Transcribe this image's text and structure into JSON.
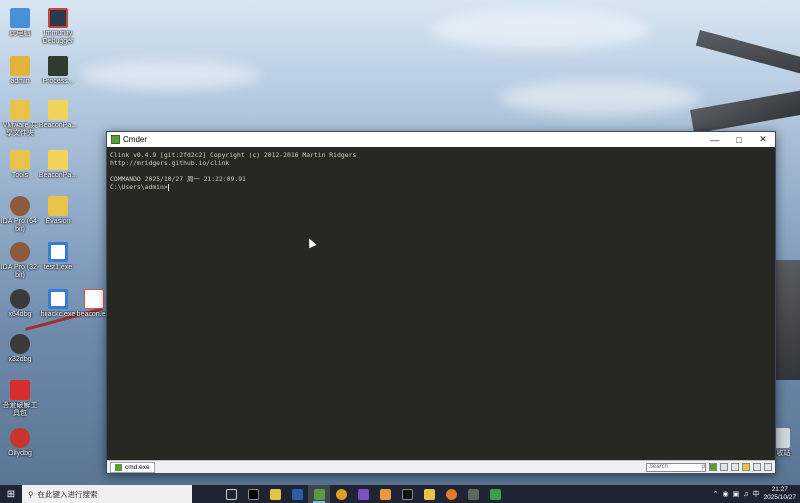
{
  "desktop": {
    "icons": [
      {
        "label": "此电脑",
        "color": "#4a90d9",
        "icon": "computer-icon"
      },
      {
        "label": "Immunity Debugger",
        "color": "#2b3b4e",
        "icon": "immunity-debugger-icon"
      },
      {
        "label": "admin",
        "color": "#e2b33a",
        "icon": "user-folder-icon"
      },
      {
        "label": "Process...",
        "color": "#2e3b2e",
        "icon": "process-monitor-icon"
      },
      {
        "label": "VMware 共享文件夹",
        "color": "#e8c34a",
        "icon": "folder-icon"
      },
      {
        "label": "BeaconPa...",
        "color": "#f2d45c",
        "icon": "file-icon"
      },
      {
        "label": "Tools",
        "color": "#e8c34a",
        "icon": "folder-icon"
      },
      {
        "label": "BeaconPa...",
        "color": "#f2d45c",
        "icon": "file-icon"
      },
      {
        "label": "IDA Pro (64-bit)",
        "color": "#8c5a3c",
        "icon": "ida-pro-icon"
      },
      {
        "label": "Evasion",
        "color": "#e8c34a",
        "icon": "folder-icon"
      },
      {
        "label": "IDA Pro (32-bit)",
        "color": "#8c5a3c",
        "icon": "ida-pro-icon"
      },
      {
        "label": "test1.exe",
        "color": "#3a7bd5",
        "icon": "exe-icon"
      },
      {
        "label": "x64dbg",
        "color": "#3a3a3a",
        "icon": "x64dbg-icon"
      },
      {
        "label": "hijackc.exe",
        "color": "#3a7bd5",
        "icon": "exe-icon"
      },
      {
        "label": "beacon.e...",
        "color": "#d9534f",
        "icon": "pdf-icon"
      },
      {
        "label": "x32dbg",
        "color": "#3a3a3a",
        "icon": "x32dbg-icon"
      },
      {
        "label": "吾爱破解工具包",
        "color": "#d62e2e",
        "icon": "toolkit-icon"
      },
      {
        "label": "Ollydbg",
        "color": "#c9342b",
        "icon": "ollydbg-icon"
      },
      {
        "label": "回收站",
        "color": "#cfd8e0",
        "icon": "recycle-bin-icon"
      }
    ]
  },
  "window": {
    "title": "Cmder",
    "console_lines": [
      "Clink v0.4.9 [git:2fd2c2] Copyright (c) 2012-2016 Martin Ridgers",
      "http://mridgers.github.io/clink",
      "",
      "COMMANDO 2025/10/27 周一 21:22:09.91",
      "C:\\Users\\admin>"
    ],
    "tab_label": "cmd.exe",
    "search_placeholder": "Search",
    "colors": {
      "console_bg": "#272822",
      "console_fg": "#cfcfc2"
    }
  },
  "taskbar": {
    "search_placeholder": "在此键入进行搜索",
    "ime": "中",
    "time": "21:27",
    "date": "2025/10/27"
  }
}
